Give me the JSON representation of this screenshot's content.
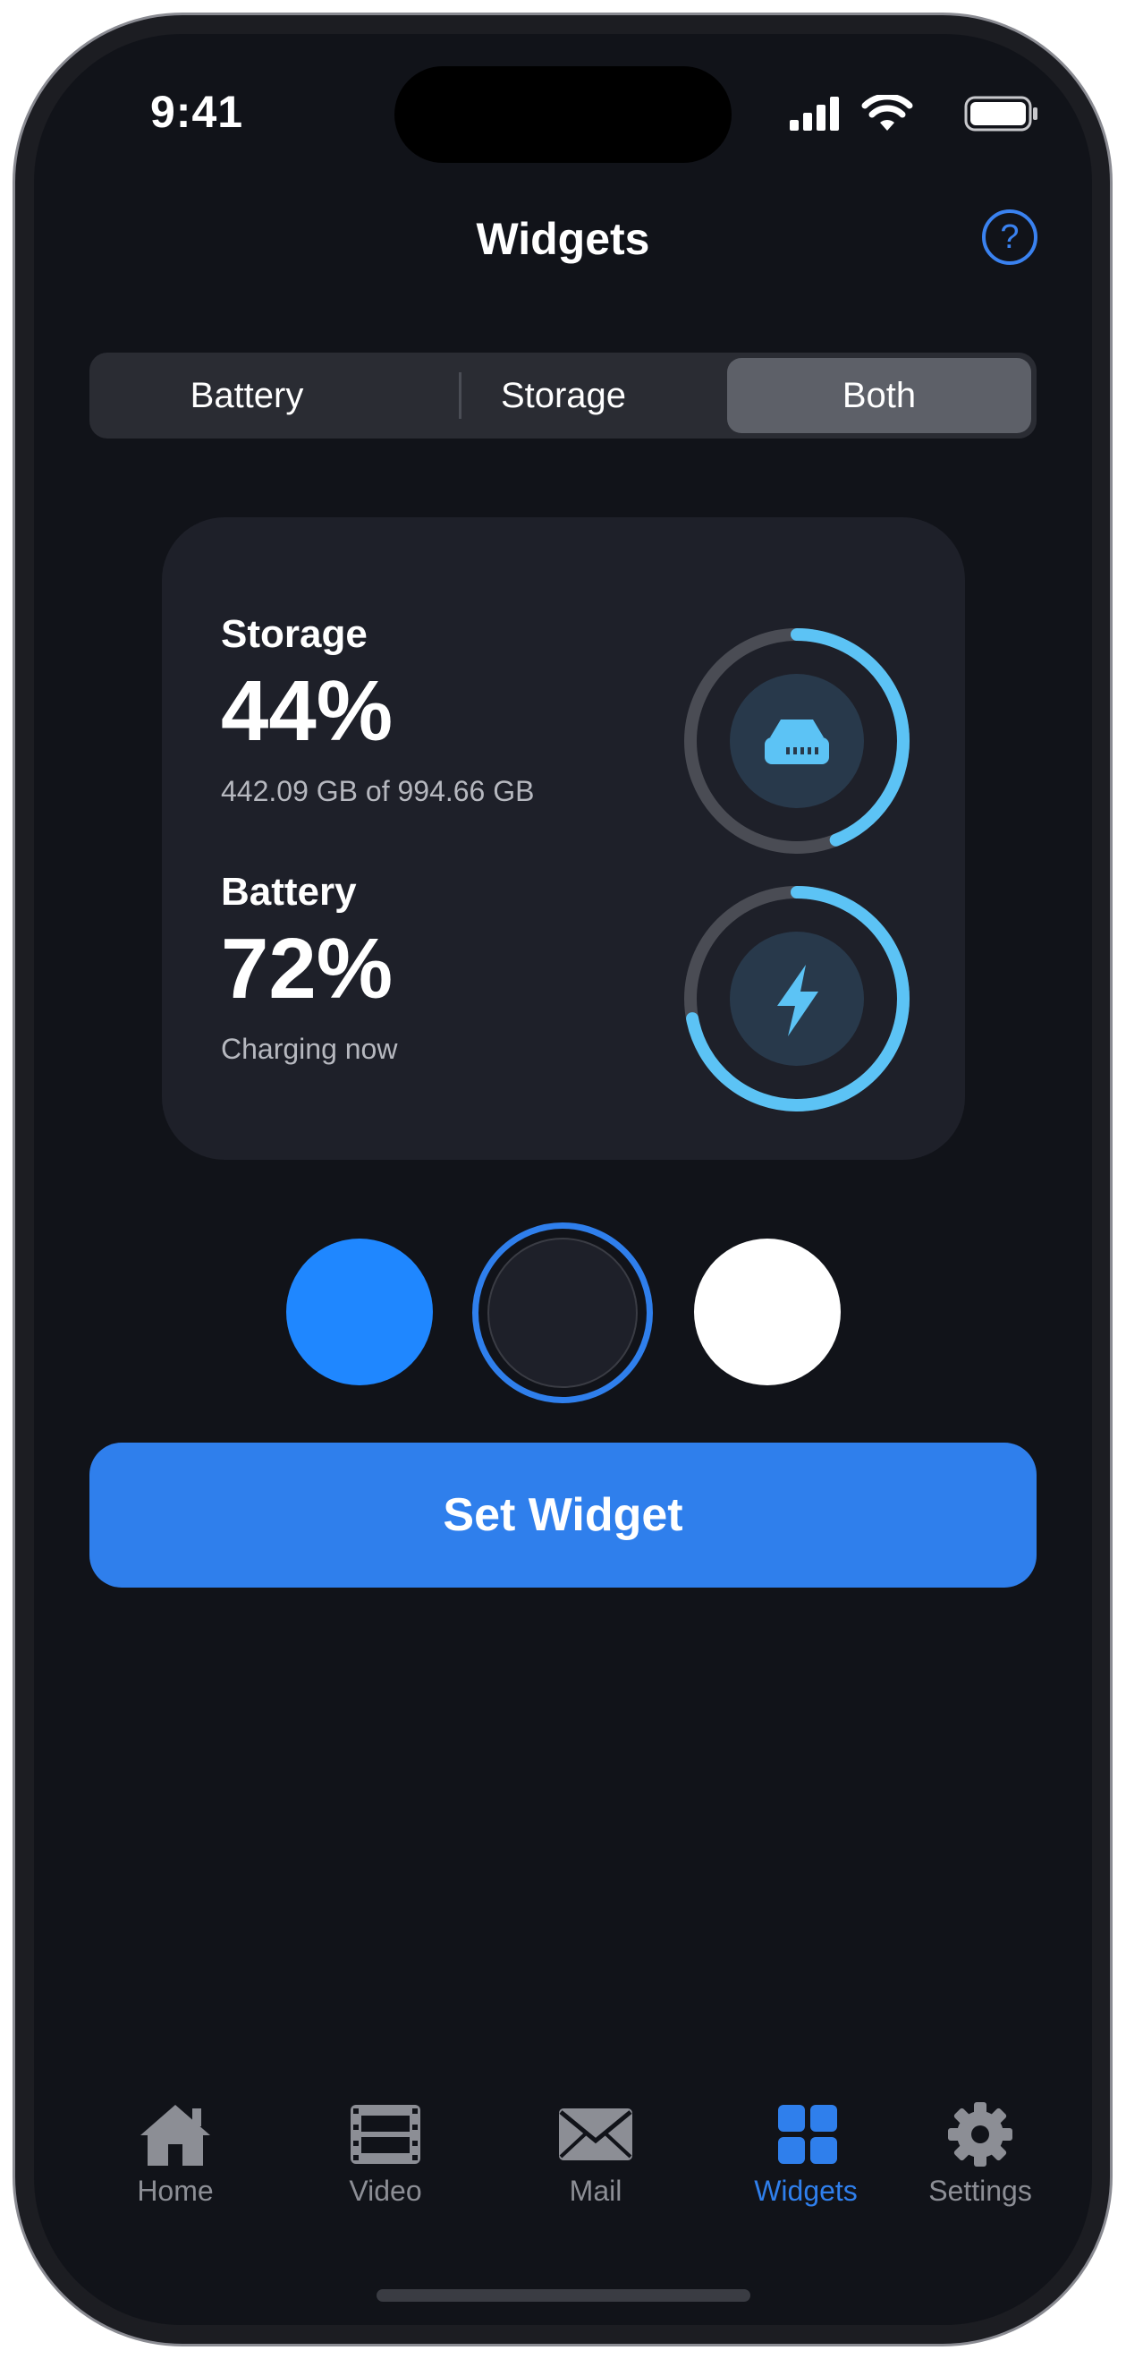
{
  "status_bar": {
    "time": "9:41",
    "icons": [
      "signal-icon",
      "wifi-icon",
      "battery-icon"
    ]
  },
  "header": {
    "title": "Widgets",
    "help_icon": "?"
  },
  "segmented_control": {
    "options": [
      "Battery",
      "Storage",
      "Both"
    ],
    "selected": "Both"
  },
  "widget": {
    "storage": {
      "label": "Storage",
      "percent_text": "44%",
      "percent": 44,
      "detail": "442.09 GB of 994.66 GB",
      "icon": "drive-icon"
    },
    "battery": {
      "label": "Battery",
      "percent_text": "72%",
      "percent": 72,
      "detail": "Charging now",
      "icon": "bolt-icon"
    }
  },
  "color_options": [
    {
      "name": "blue",
      "color": "#1f87ff",
      "selected": false
    },
    {
      "name": "dark",
      "color": "#1e2029",
      "selected": true
    },
    {
      "name": "white",
      "color": "#ffffff",
      "selected": false
    }
  ],
  "primary_action": {
    "label": "Set Widget"
  },
  "tab_bar": {
    "items": [
      {
        "label": "Home",
        "icon": "home-icon",
        "active": false
      },
      {
        "label": "Video",
        "icon": "video-icon",
        "active": false
      },
      {
        "label": "Mail",
        "icon": "mail-icon",
        "active": false
      },
      {
        "label": "Widgets",
        "icon": "widgets-icon",
        "active": true
      },
      {
        "label": "Settings",
        "icon": "gear-icon",
        "active": false
      }
    ]
  },
  "colors": {
    "accent": "#2f7fec",
    "ring_fill": "#5cc3f5",
    "ring_track": "#4a4c54",
    "inactive_tab": "#8c8e95"
  }
}
